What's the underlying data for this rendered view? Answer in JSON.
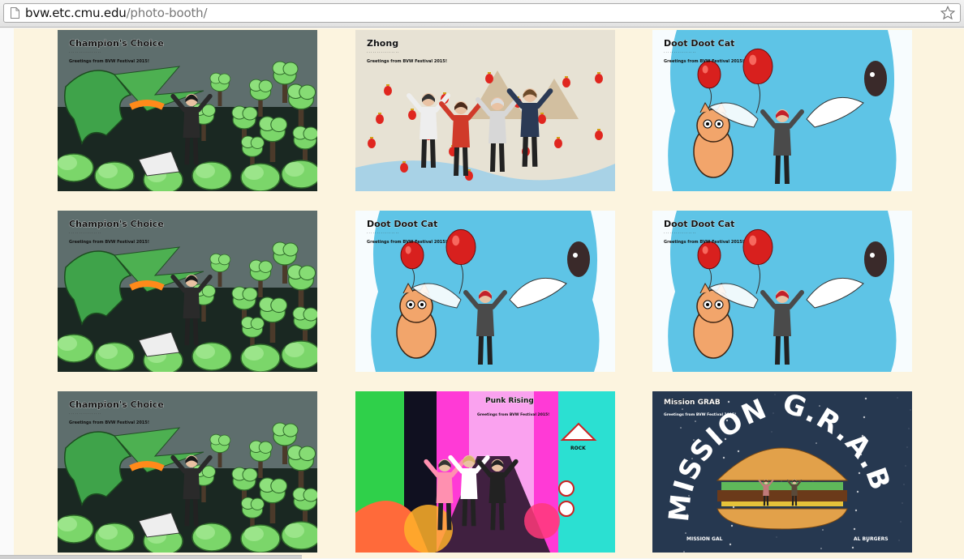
{
  "browser": {
    "url_host": "bvw.etc.cmu.edu",
    "url_path": "/photo-booth/"
  },
  "gallery": {
    "photos": [
      {
        "title": "Champion's Choice",
        "greeting": "Greetings from BVW Festival 2015!",
        "scene": "dragon-forest"
      },
      {
        "title": "Zhong",
        "greeting": "Greetings from BVW Festival 2015!",
        "scene": "lanterns"
      },
      {
        "title": "Doot Doot Cat",
        "greeting": "Greetings from BVW Festival 2015!",
        "scene": "cat-balloons"
      },
      {
        "title": "Champion's Choice",
        "greeting": "Greetings from BVW Festival 2015!",
        "scene": "dragon-forest"
      },
      {
        "title": "Doot Doot Cat",
        "greeting": "Greetings from BVW Festival 2015!",
        "scene": "cat-balloons"
      },
      {
        "title": "Doot Doot Cat",
        "greeting": "Greetings from BVW Festival 2015!",
        "scene": "cat-balloons"
      },
      {
        "title": "Champion's Choice",
        "greeting": "Greetings from BVW Festival 2015!",
        "scene": "dragon-forest"
      },
      {
        "title": "Punk Rising",
        "greeting": "Greetings from BVW Festival 2015!",
        "scene": "punk",
        "sign": "ROCK"
      },
      {
        "title": "Mission GRAB",
        "greeting": "Greetings from BVW Festival 2015!",
        "scene": "space-burger",
        "big_text": "MISSION G.R.A.B",
        "bottom_text": "MISSION GAL",
        "bottom_text_right": "AL BURGERS"
      }
    ]
  },
  "colors": {
    "page_background": "#fcf4df",
    "forest_sky": "#5e6e6d",
    "forest_ground": "#1a2822",
    "tree_green": "#7bd66a",
    "sky_blue": "#5ec4e6",
    "balloon_red": "#d8201e",
    "space_navy": "#263850"
  }
}
